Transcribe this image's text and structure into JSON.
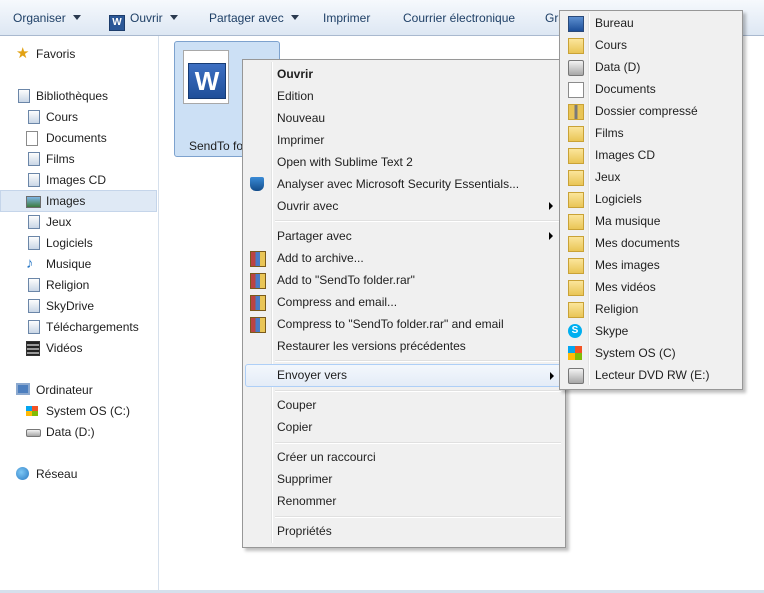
{
  "toolbar": {
    "organize": "Organiser",
    "open": "Ouvrir",
    "share": "Partager avec",
    "print": "Imprimer",
    "email": "Courrier électronique",
    "burn": "Gra"
  },
  "nav": {
    "favorites": "Favoris",
    "libraries": "Bibliothèques",
    "library_items": [
      "Cours",
      "Documents",
      "Films",
      "Images CD",
      "Images",
      "Jeux",
      "Logiciels",
      "Musique",
      "Religion",
      "SkyDrive",
      "Téléchargements",
      "Vidéos"
    ],
    "computer": "Ordinateur",
    "drives": [
      "System OS (C:)",
      "Data (D:)"
    ],
    "network": "Réseau"
  },
  "file": {
    "name": "SendTo fo"
  },
  "context_menu": {
    "items": [
      "Ouvrir",
      "Edition",
      "Nouveau",
      "Imprimer",
      "Open with Sublime Text 2",
      "Analyser avec Microsoft Security Essentials...",
      "Ouvrir avec",
      "Partager avec",
      "Add to archive...",
      "Add to \"SendTo folder.rar\"",
      "Compress and email...",
      "Compress to \"SendTo folder.rar\" and email",
      "Restaurer les versions précédentes",
      "Envoyer vers",
      "Couper",
      "Copier",
      "Créer un raccourci",
      "Supprimer",
      "Renommer",
      "Propriétés"
    ]
  },
  "send_to": {
    "items": [
      "Bureau",
      "Cours",
      "Data (D)",
      "Documents",
      "Dossier compressé",
      "Films",
      "Images CD",
      "Jeux",
      "Logiciels",
      "Ma musique",
      "Mes documents",
      "Mes images",
      "Mes vidéos",
      "Religion",
      "Skype",
      "System OS (C)",
      "Lecteur DVD RW (E:)"
    ]
  },
  "icons": {
    "word": "W",
    "skype": "S",
    "star": "★",
    "note": "♪"
  }
}
